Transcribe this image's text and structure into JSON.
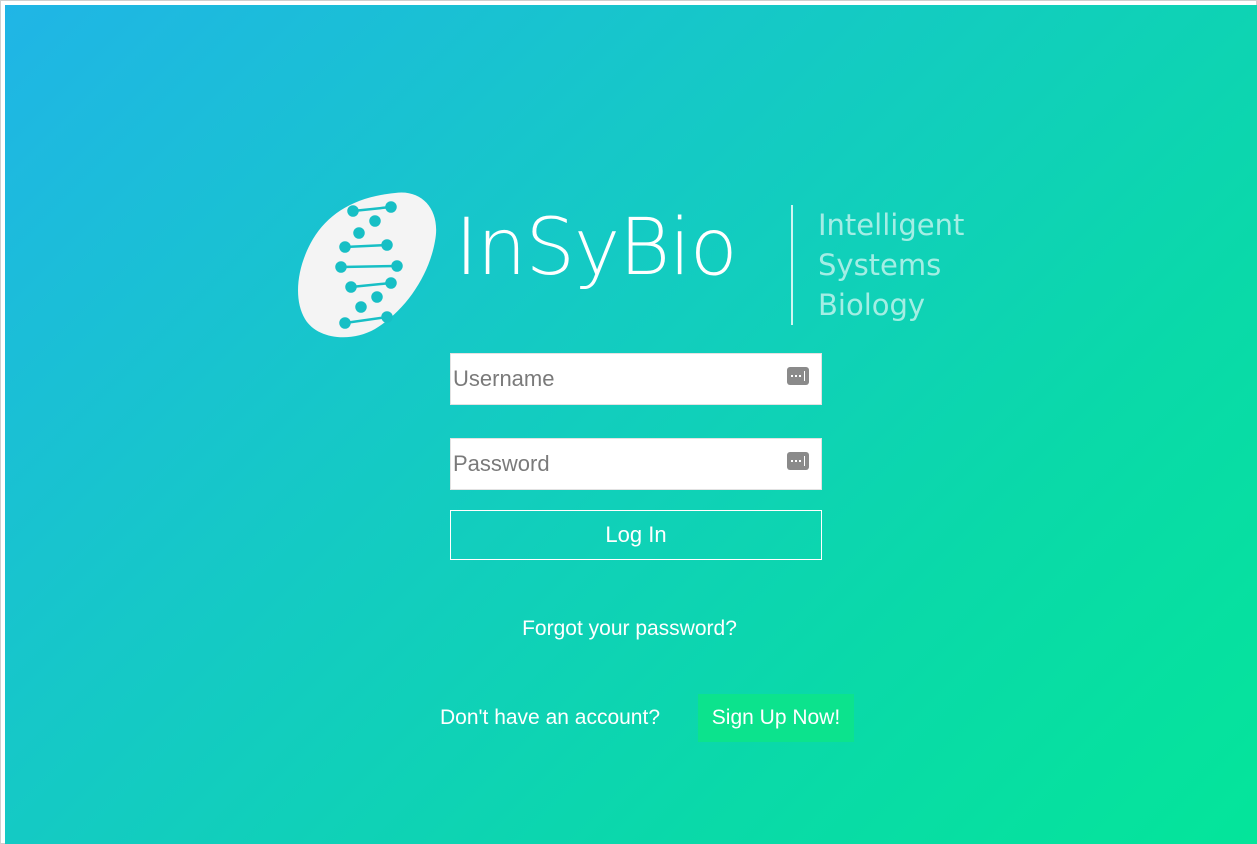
{
  "logo": {
    "mark_icon": "dna-helix-icon",
    "brand_name": "InSyBio",
    "tagline": [
      "Intelligent",
      "Systems",
      "Biology"
    ]
  },
  "form": {
    "username": {
      "placeholder": "Username",
      "value": "",
      "icon": "password-manager-key-icon"
    },
    "password": {
      "placeholder": "Password",
      "value": "",
      "icon": "password-manager-key-icon"
    },
    "login_label": "Log In"
  },
  "links": {
    "forgot_password": "Forgot your password?",
    "no_account_text": "Don't have an account?",
    "signup_label": "Sign Up Now!"
  },
  "colors": {
    "gradient_start": "#20b5e6",
    "gradient_end": "#04e59a",
    "signup_highlight": "#0ce38d",
    "logo_dna": "#17bfc5"
  }
}
